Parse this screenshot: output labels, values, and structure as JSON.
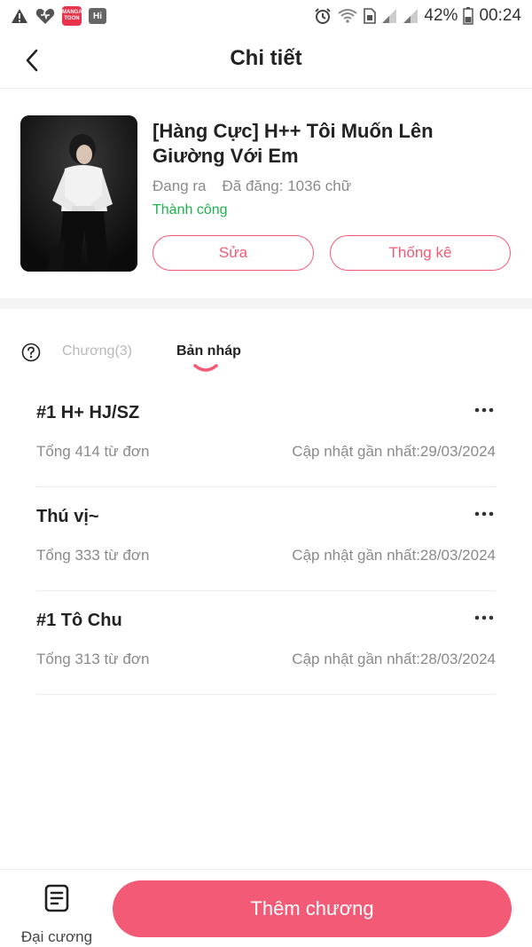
{
  "status_bar": {
    "battery": "42%",
    "time": "00:24",
    "app_badge_line1": "MANGA",
    "app_badge_line2": "TOON",
    "hi_badge": "Hi"
  },
  "header": {
    "title": "Chi tiết"
  },
  "book": {
    "title": "[Hàng Cực] H++ Tôi Muốn Lên Giường Với Em",
    "state": "Đang ra",
    "published": "Đã đăng: 1036 chữ",
    "review_status": "Thành công",
    "edit_label": "Sửa",
    "stats_label": "Thống kê"
  },
  "tabs": {
    "chapters_label": "Chương(3)",
    "drafts_label": "Bản nháp"
  },
  "drafts": [
    {
      "title": "#1 H+ HJ/SZ",
      "words": "Tổng 414 từ đơn",
      "updated": "Cập nhật gần nhất:29/03/2024"
    },
    {
      "title": "Thú vị~",
      "words": "Tổng 333 từ đơn",
      "updated": "Cập nhật gần nhất:28/03/2024"
    },
    {
      "title": "#1 Tô Chu",
      "words": "Tổng 313 từ đơn",
      "updated": "Cập nhật gần nhất:28/03/2024"
    }
  ],
  "bottom": {
    "outline_label": "Đại cương",
    "add_chapter_label": "Thêm chương"
  },
  "colors": {
    "accent": "#f25a76",
    "success": "#1db24a"
  }
}
